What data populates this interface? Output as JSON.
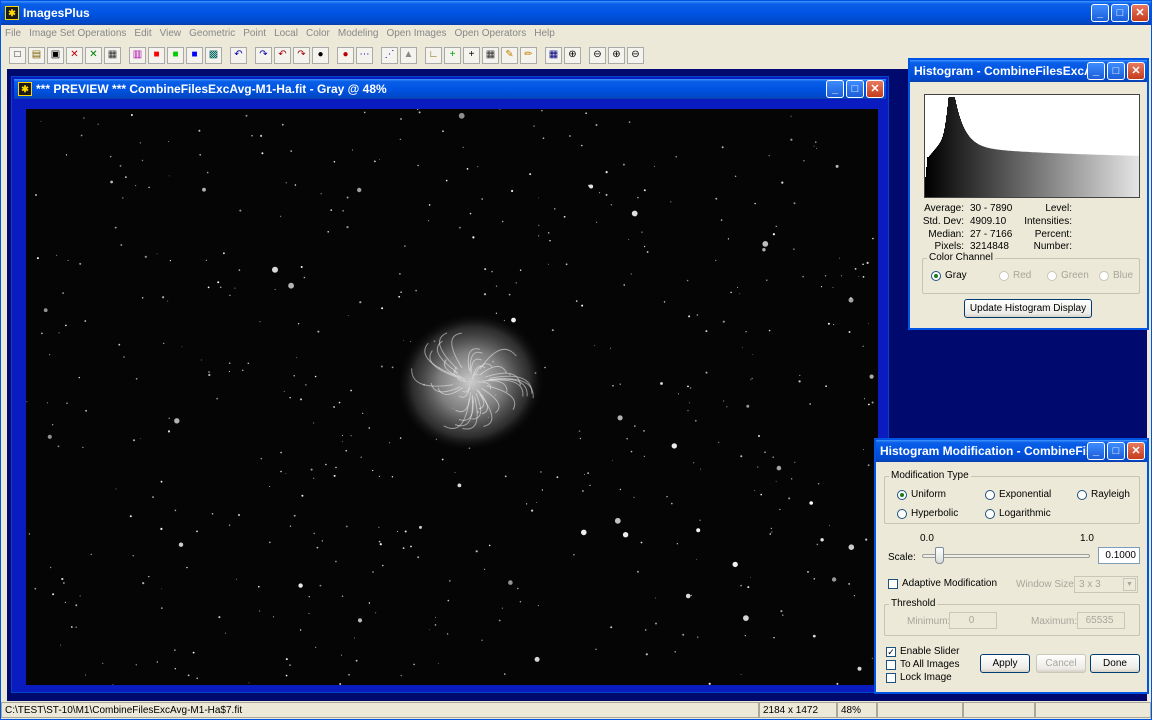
{
  "app": {
    "title": "ImagesPlus"
  },
  "menu": [
    "File",
    "Image Set Operations",
    "Edit",
    "View",
    "Geometric",
    "Point",
    "Local",
    "Color",
    "Modeling",
    "Open Images",
    "Open Operators",
    "Help"
  ],
  "toolbar": {
    "icons": [
      "new-icon",
      "open-icon",
      "save-icon",
      "close-red-icon",
      "close-green-icon",
      "print-icon",
      "rgb-icon",
      "red-icon",
      "green-icon",
      "blue-icon",
      "grid-icon",
      "undo-icon",
      "redo-icon",
      "undo-all-icon",
      "redo-all-icon",
      "dot-black-icon",
      "dot-red-icon",
      "dots-icon",
      "marker-icon",
      "triangle-icon",
      "measure-icon",
      "crosshair-green-icon",
      "crosshair-icon",
      "calculator-icon",
      "paint-icon",
      "pencil-icon",
      "table-icon",
      "zoom-in-icon",
      "zoom-out-icon",
      "zoom-fit-icon",
      "zoom-actual-icon"
    ],
    "glyphs": [
      "□",
      "▤",
      "▣",
      "✕",
      "✕",
      "▦",
      "▥",
      "■",
      "■",
      "■",
      "▩",
      "↶",
      "↷",
      "↶",
      "↷",
      "●",
      "●",
      "⋯",
      "⋰",
      "▲",
      "∟",
      "+",
      "+",
      "▦",
      "✎",
      "✏",
      "▦",
      "⊕",
      "⊖",
      "⊕",
      "⊖"
    ],
    "colors": [
      "#000",
      "#806000",
      "#000",
      "#c00000",
      "#008000",
      "#333",
      "#aa00aa",
      "#ff0000",
      "#00cc00",
      "#0000ff",
      "#006060",
      "#0000a0",
      "#0000a0",
      "#a00000",
      "#a00000",
      "#000",
      "#c00000",
      "#0000c0",
      "#0000c0",
      "#888",
      "#806000",
      "#00a000",
      "#000",
      "#333",
      "#c08000",
      "#c08000",
      "#000080",
      "#000",
      "#000",
      "#000",
      "#000"
    ]
  },
  "preview": {
    "title": "*** PREVIEW *** CombineFilesExcAvg-M1-Ha.fit - Gray @ 48%"
  },
  "histogram": {
    "title": "Histogram - CombineFilesExcAvg-...",
    "stats": {
      "average_label": "Average:",
      "average": "30 - 7890",
      "stddev_label": "Std. Dev:",
      "stddev": "4909.10",
      "median_label": "Median:",
      "median": "27 - 7166",
      "pixels_label": "Pixels:",
      "pixels": "3214848",
      "level_label": "Level:",
      "intensities_label": "Intensities:",
      "percent_label": "Percent:",
      "number_label": "Number:"
    },
    "color_channel": {
      "legend": "Color Channel",
      "gray": "Gray",
      "red": "Red",
      "green": "Green",
      "blue": "Blue"
    },
    "update_button": "Update Histogram Display"
  },
  "histmod": {
    "title": "Histogram Modification - CombineFilesE...",
    "modification_type": {
      "legend": "Modification Type",
      "uniform": "Uniform",
      "exponential": "Exponential",
      "rayleigh": "Rayleigh",
      "hyperbolic": "Hyperbolic",
      "logarithmic": "Logarithmic"
    },
    "scale": {
      "min_label": "0.0",
      "max_label": "1.0",
      "label": "Scale:",
      "value": "0.1000",
      "slider_fraction": 0.1
    },
    "adaptive": {
      "label": "Adaptive Modification",
      "window_size_label": "Window Size:",
      "window_size_value": "3 x 3"
    },
    "threshold": {
      "legend": "Threshold",
      "min_label": "Minimum:",
      "min_value": "0",
      "max_label": "Maximum:",
      "max_value": "65535"
    },
    "enable_slider": "Enable Slider",
    "to_all_images": "To All Images",
    "lock_image": "Lock Image",
    "apply_button": "Apply",
    "cancel_button": "Cancel",
    "done_button": "Done"
  },
  "status": {
    "path": "C:\\TEST\\ST-10\\M1\\CombineFilesExcAvg-M1-Ha$7.fit",
    "dimensions": "2184 x 1472",
    "zoom": "48%"
  },
  "colors": {
    "title_blue": "#0054e3",
    "desktop": "#000a6e",
    "preview_border": "#0a1cc0"
  }
}
